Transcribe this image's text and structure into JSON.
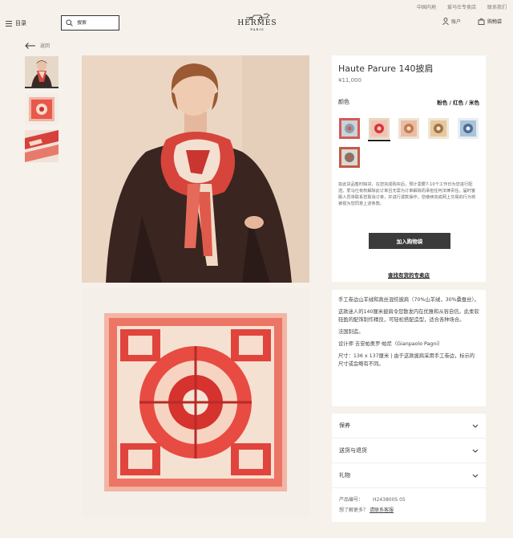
{
  "utility_links": [
    "中国内地",
    "爱马仕专卖店",
    "联系我们"
  ],
  "header": {
    "menu_label": "目录",
    "search_placeholder": "搜索",
    "logo_text": "HERMES",
    "logo_subtext": "PARIS",
    "account_label": "账户",
    "cart_label": "购物袋"
  },
  "back_label": "返回",
  "product": {
    "title": "Haute Parure 140披肩",
    "price": "¥11,000",
    "color_label": "颜色",
    "color_value": "粉色 / 红色 / 米色",
    "swatches": [
      {
        "name": "grey-blue",
        "colors": [
          "#c9d3d8",
          "#8aa0ac",
          "#d45a55"
        ]
      },
      {
        "name": "pink-red-beige",
        "colors": [
          "#f2c2b4",
          "#d8343a",
          "#e9d6c2"
        ]
      },
      {
        "name": "orange-beige",
        "colors": [
          "#e9bda5",
          "#c97a4a",
          "#efe3d4"
        ]
      },
      {
        "name": "gold-tan",
        "colors": [
          "#e7c79d",
          "#a0744a",
          "#f1e6d5"
        ]
      },
      {
        "name": "blue",
        "colors": [
          "#aac3d8",
          "#4d6d95",
          "#e8eef2"
        ]
      },
      {
        "name": "grey-neutral",
        "colors": [
          "#ddd8d0",
          "#7c7670",
          "#c45a45"
        ]
      }
    ],
    "selected_swatch": 1,
    "notice": "如此货品暂时缺货，在您完成购买后，预计需要7-10个工作日为您进行配送。爱马仕有权解除此订单且无需为订单解除而承担任何法律责任。届时客服人员将联系您取消订单，并进行退款操作。您继续完成网上交易的行为将被视为您同意上述条款。",
    "add_to_cart": "加入购物袋",
    "find_store": "查找有货的专卖店"
  },
  "description": {
    "p1": "手工卷边山羊绒和真丝混纺披肩（70%山羊绒，30%桑蚕丝）。",
    "p2": "这款迷人的140厘米披肩令您散发内在优雅和从容自信。此柔软轻盈的配饰制作精良，可轻松搭配造型，适合各种场合。",
    "p3": "法国制造。",
    "p4": "设计师 吉安帕奥罗·帕尼（Gianpaolo Pagni）",
    "p5": "尺寸：136 x 137厘米 | 由于这款披肩采用手工卷边，标示的尺寸或会略有不同。"
  },
  "accordion": [
    "保养",
    "送货与退货",
    "礼物"
  ],
  "meta": {
    "product_code_label": "产品编号：",
    "product_code": "H243800S 05",
    "more_label": "想了解更多？",
    "contact_label": "请联系客服"
  },
  "colors": {
    "background": "#f6f1eb",
    "panel": "#ffffff",
    "button": "#3b3b3b"
  }
}
